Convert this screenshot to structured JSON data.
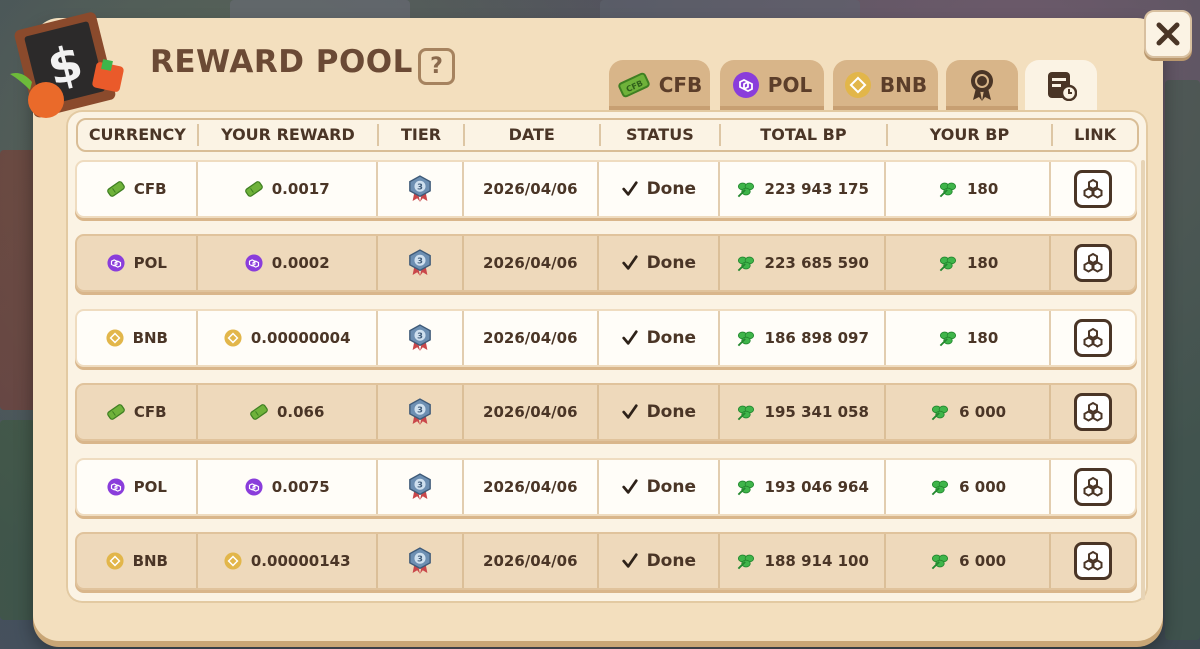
{
  "header": {
    "title": "REWARD POOL",
    "help_label": "?",
    "close_label": "✕"
  },
  "tabs": [
    {
      "label": "CFB",
      "icon": "cfb-ticket-icon"
    },
    {
      "label": "POL",
      "icon": "pol-coin-icon"
    },
    {
      "label": "BNB",
      "icon": "bnb-coin-icon"
    },
    {
      "label": "",
      "icon": "award-badge-icon"
    },
    {
      "label": "",
      "icon": "history-icon",
      "active": true
    }
  ],
  "columns": [
    "CURRENCY",
    "YOUR REWARD",
    "TIER",
    "DATE",
    "STATUS",
    "TOTAL BP",
    "YOUR BP",
    "LINK"
  ],
  "rows": [
    {
      "currency": "CFB",
      "reward": "0.0017",
      "tier": "3",
      "date": "2026/04/06",
      "status": "Done",
      "total_bp": "223 943 175",
      "your_bp": "180"
    },
    {
      "currency": "POL",
      "reward": "0.0002",
      "tier": "3",
      "date": "2026/04/06",
      "status": "Done",
      "total_bp": "223 685 590",
      "your_bp": "180"
    },
    {
      "currency": "BNB",
      "reward": "0.00000004",
      "tier": "3",
      "date": "2026/04/06",
      "status": "Done",
      "total_bp": "186 898 097",
      "your_bp": "180"
    },
    {
      "currency": "CFB",
      "reward": "0.066",
      "tier": "3",
      "date": "2026/04/06",
      "status": "Done",
      "total_bp": "195 341 058",
      "your_bp": "6 000"
    },
    {
      "currency": "POL",
      "reward": "0.0075",
      "tier": "3",
      "date": "2026/04/06",
      "status": "Done",
      "total_bp": "193 046 964",
      "your_bp": "6 000"
    },
    {
      "currency": "BNB",
      "reward": "0.00000143",
      "tier": "3",
      "date": "2026/04/06",
      "status": "Done",
      "total_bp": "188 914 100",
      "your_bp": "6 000"
    }
  ],
  "colors": {
    "cfb": "#6fb23a",
    "pol": "#8a3ddb",
    "bnb": "#e2b64a",
    "bp_clover": "#3fb54a",
    "text": "#4a3526"
  }
}
